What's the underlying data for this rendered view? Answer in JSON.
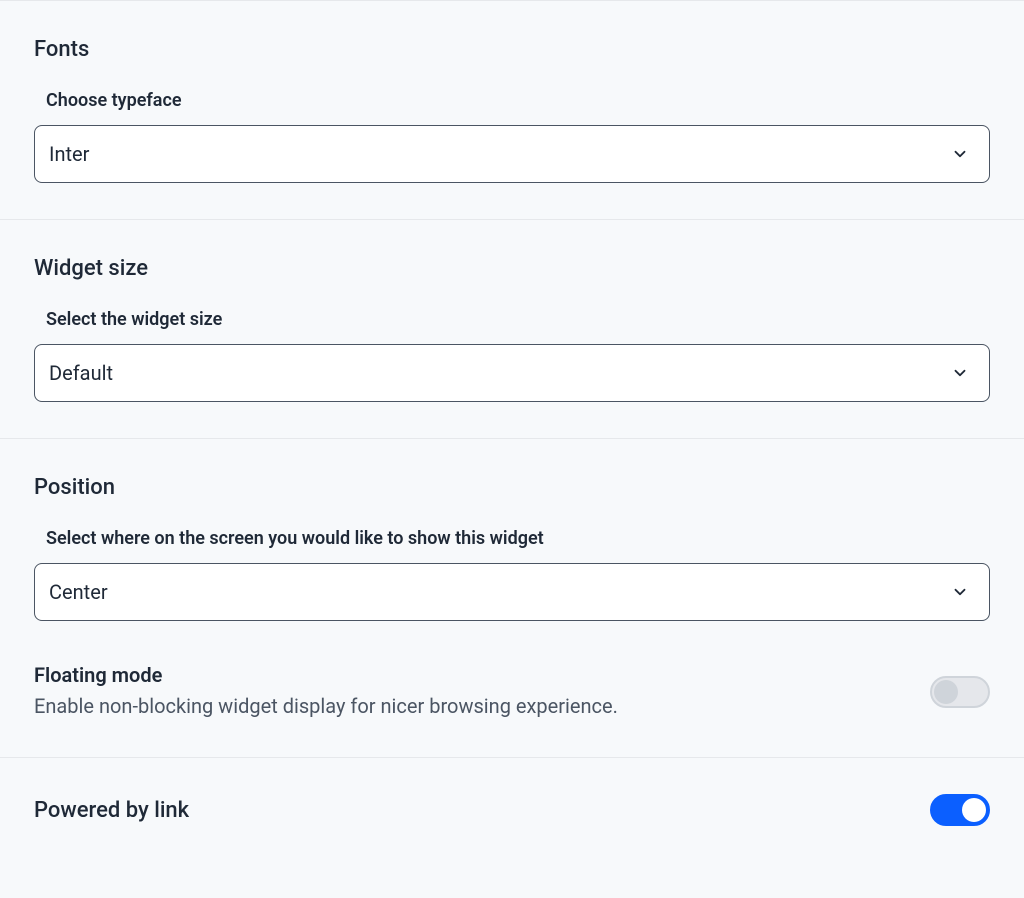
{
  "fonts": {
    "section_title": "Fonts",
    "field_label": "Choose typeface",
    "selected": "Inter"
  },
  "widget_size": {
    "section_title": "Widget size",
    "field_label": "Select the widget size",
    "selected": "Default"
  },
  "position": {
    "section_title": "Position",
    "field_label": "Select where on the screen you would like to show this widget",
    "selected": "Center",
    "floating": {
      "title": "Floating mode",
      "description": "Enable non-blocking widget display for nicer browsing experience.",
      "enabled": false
    }
  },
  "powered_by": {
    "title": "Powered by link",
    "enabled": true
  }
}
